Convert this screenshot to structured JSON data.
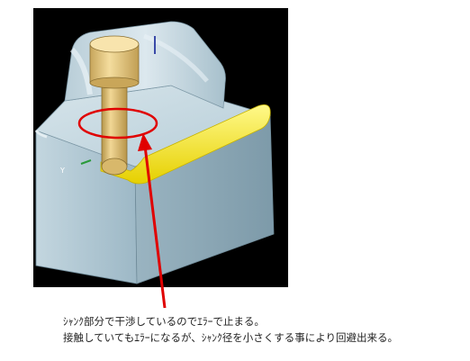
{
  "viewport": {
    "background": "#000000",
    "axis_labels": {
      "y": "Y"
    }
  },
  "annotation": {
    "color": "#e00000"
  },
  "caption": {
    "line1": "ｼｬﾝｸ部分で干渉しているのでｴﾗｰで止まる。",
    "line2": "接触していてもｴﾗｰになるが、ｼｬﾝｸ径を小さくする事により回避出来る。"
  },
  "colors": {
    "part": "#a7c3d0",
    "tool": "#e3c275",
    "toolpath": "#ffee00"
  }
}
